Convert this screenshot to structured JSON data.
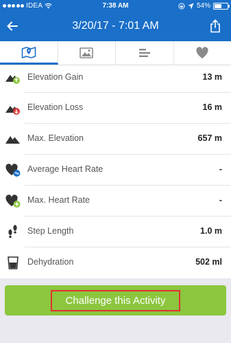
{
  "status_bar": {
    "carrier": "IDEA",
    "time": "7:38 AM",
    "battery": "54%",
    "battery_level": 0.54
  },
  "header": {
    "title": "3/20/17 - 7:01 AM",
    "back_icon": "back-arrow-icon",
    "share_icon": "share-icon"
  },
  "tabs": [
    {
      "icon": "map-icon",
      "active": true
    },
    {
      "icon": "photo-icon",
      "active": false
    },
    {
      "icon": "splits-icon",
      "active": false
    },
    {
      "icon": "heart-icon",
      "active": false
    }
  ],
  "stats": [
    {
      "label": "Elevation Gain",
      "value": "13 m",
      "icon": "elevation-gain-icon"
    },
    {
      "label": "Elevation Loss",
      "value": "16 m",
      "icon": "elevation-loss-icon"
    },
    {
      "label": "Max. Elevation",
      "value": "657 m",
      "icon": "max-elevation-icon"
    },
    {
      "label": "Average Heart Rate",
      "value": "-",
      "icon": "average-heart-rate-icon"
    },
    {
      "label": "Max. Heart Rate",
      "value": "-",
      "icon": "max-heart-rate-icon"
    },
    {
      "label": "Step Length",
      "value": "1.0 m",
      "icon": "step-length-icon"
    },
    {
      "label": "Dehydration",
      "value": "502 ml",
      "icon": "dehydration-icon"
    }
  ],
  "footer": {
    "challenge_label": "Challenge this Activity"
  },
  "colors": {
    "header_blue": "#1a6fc9",
    "button_green": "#8cc63f",
    "highlight_red": "#e0312f"
  }
}
